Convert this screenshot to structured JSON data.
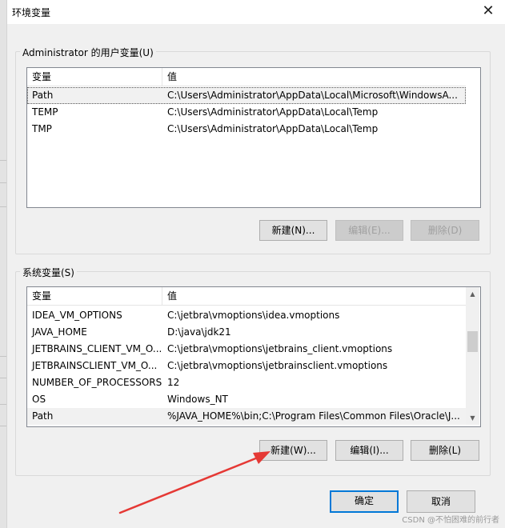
{
  "window": {
    "title": "环境变量",
    "close_glyph": "✕"
  },
  "user_vars": {
    "group_label": "Administrator 的用户变量(U)",
    "columns": {
      "name": "变量",
      "value": "值"
    },
    "rows": [
      {
        "name": "Path",
        "value": "C:\\Users\\Administrator\\AppData\\Local\\Microsoft\\WindowsA..."
      },
      {
        "name": "TEMP",
        "value": "C:\\Users\\Administrator\\AppData\\Local\\Temp"
      },
      {
        "name": "TMP",
        "value": "C:\\Users\\Administrator\\AppData\\Local\\Temp"
      }
    ],
    "buttons": {
      "new": "新建(N)...",
      "edit": "编辑(E)...",
      "delete": "删除(D)"
    }
  },
  "system_vars": {
    "group_label": "系统变量(S)",
    "columns": {
      "name": "变量",
      "value": "值"
    },
    "rows": [
      {
        "name": "IDEA_VM_OPTIONS",
        "value": "C:\\jetbra\\vmoptions\\idea.vmoptions"
      },
      {
        "name": "JAVA_HOME",
        "value": "D:\\java\\jdk21"
      },
      {
        "name": "JETBRAINS_CLIENT_VM_O...",
        "value": "C:\\jetbra\\vmoptions\\jetbrains_client.vmoptions"
      },
      {
        "name": "JETBRAINSCLIENT_VM_O...",
        "value": "C:\\jetbra\\vmoptions\\jetbrainsclient.vmoptions"
      },
      {
        "name": "NUMBER_OF_PROCESSORS",
        "value": "12"
      },
      {
        "name": "OS",
        "value": "Windows_NT"
      },
      {
        "name": "Path",
        "value": "%JAVA_HOME%\\bin;C:\\Program Files\\Common Files\\Oracle\\J..."
      }
    ],
    "buttons": {
      "new": "新建(W)...",
      "edit": "编辑(I)...",
      "delete": "删除(L)"
    }
  },
  "footer": {
    "ok": "确定",
    "cancel": "取消"
  },
  "watermark": "CSDN @不怕困难的前行者",
  "colors": {
    "annotation_arrow": "#e53935",
    "default_button_border": "#0078d7"
  }
}
